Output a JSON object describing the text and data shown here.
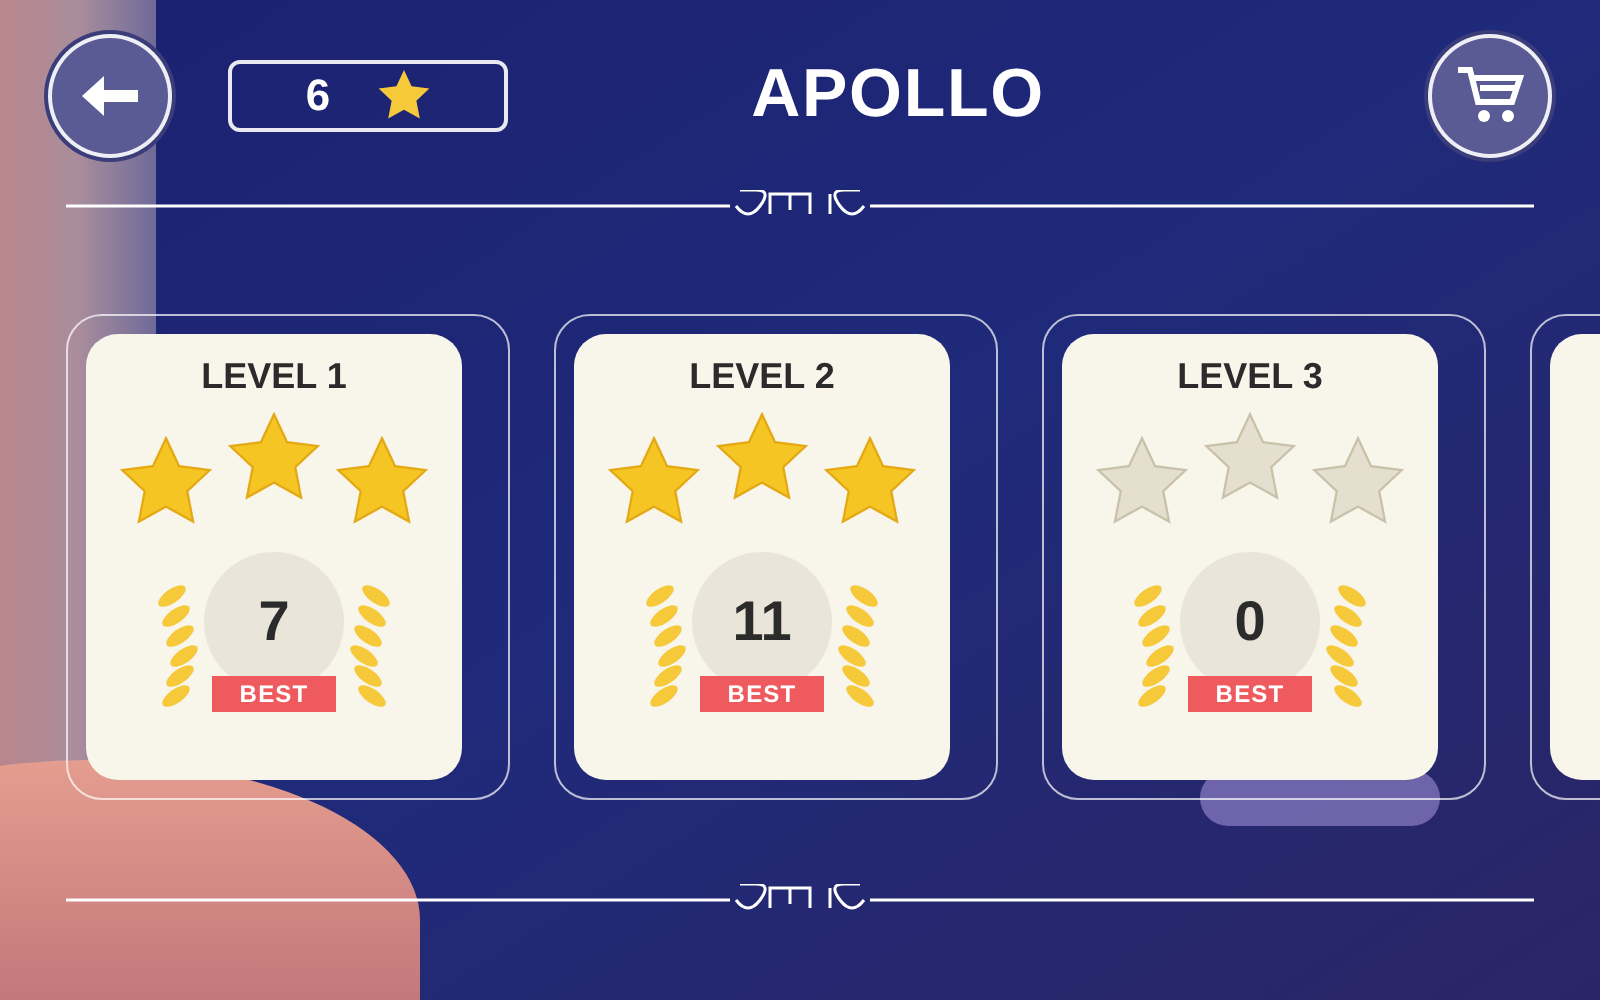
{
  "header": {
    "star_count": "6",
    "title": "APOLLO"
  },
  "levels": [
    {
      "title": "LEVEL 1",
      "stars": 3,
      "best": "7",
      "best_label": "BEST",
      "kind": "card"
    },
    {
      "title": "LEVEL 2",
      "stars": 3,
      "best": "11",
      "best_label": "BEST",
      "kind": "card"
    },
    {
      "title": "LEVEL 3",
      "stars": 0,
      "best": "0",
      "best_label": "BEST",
      "kind": "card"
    },
    {
      "kind": "partial"
    }
  ]
}
